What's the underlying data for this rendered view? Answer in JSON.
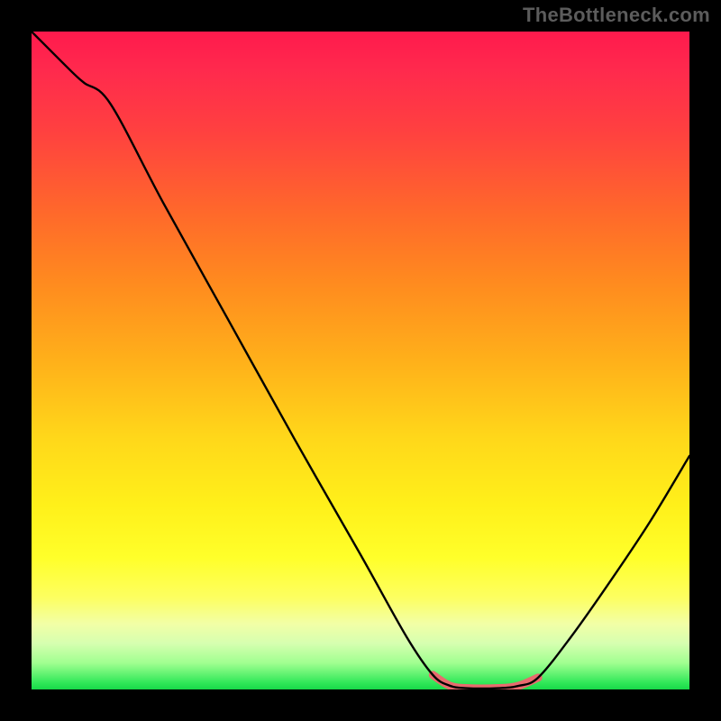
{
  "watermark": "TheBottleneck.com",
  "chart_data": {
    "type": "line",
    "title": "",
    "xlabel": "",
    "ylabel": "",
    "xlim": [
      0,
      100
    ],
    "ylim": [
      0,
      100
    ],
    "curve_points": [
      {
        "x": 0,
        "y": 100
      },
      {
        "x": 6,
        "y": 94
      },
      {
        "x": 8,
        "y": 92.2
      },
      {
        "x": 12,
        "y": 89
      },
      {
        "x": 20,
        "y": 74
      },
      {
        "x": 30,
        "y": 56
      },
      {
        "x": 40,
        "y": 38
      },
      {
        "x": 50,
        "y": 20.5
      },
      {
        "x": 57,
        "y": 8
      },
      {
        "x": 61,
        "y": 2.2
      },
      {
        "x": 63.5,
        "y": 0.6
      },
      {
        "x": 66,
        "y": 0.2
      },
      {
        "x": 71,
        "y": 0.2
      },
      {
        "x": 74,
        "y": 0.55
      },
      {
        "x": 77,
        "y": 1.8
      },
      {
        "x": 82,
        "y": 8
      },
      {
        "x": 88,
        "y": 16.5
      },
      {
        "x": 94,
        "y": 25.5
      },
      {
        "x": 100,
        "y": 35.5
      }
    ],
    "highlight_segment": {
      "start_x": 62,
      "end_x": 76,
      "color": "#e86a6e",
      "stroke_width": 9
    },
    "background_gradient": {
      "top": "#ff1a4d",
      "mid": "#ffff2a",
      "bottom": "#18d848"
    }
  }
}
